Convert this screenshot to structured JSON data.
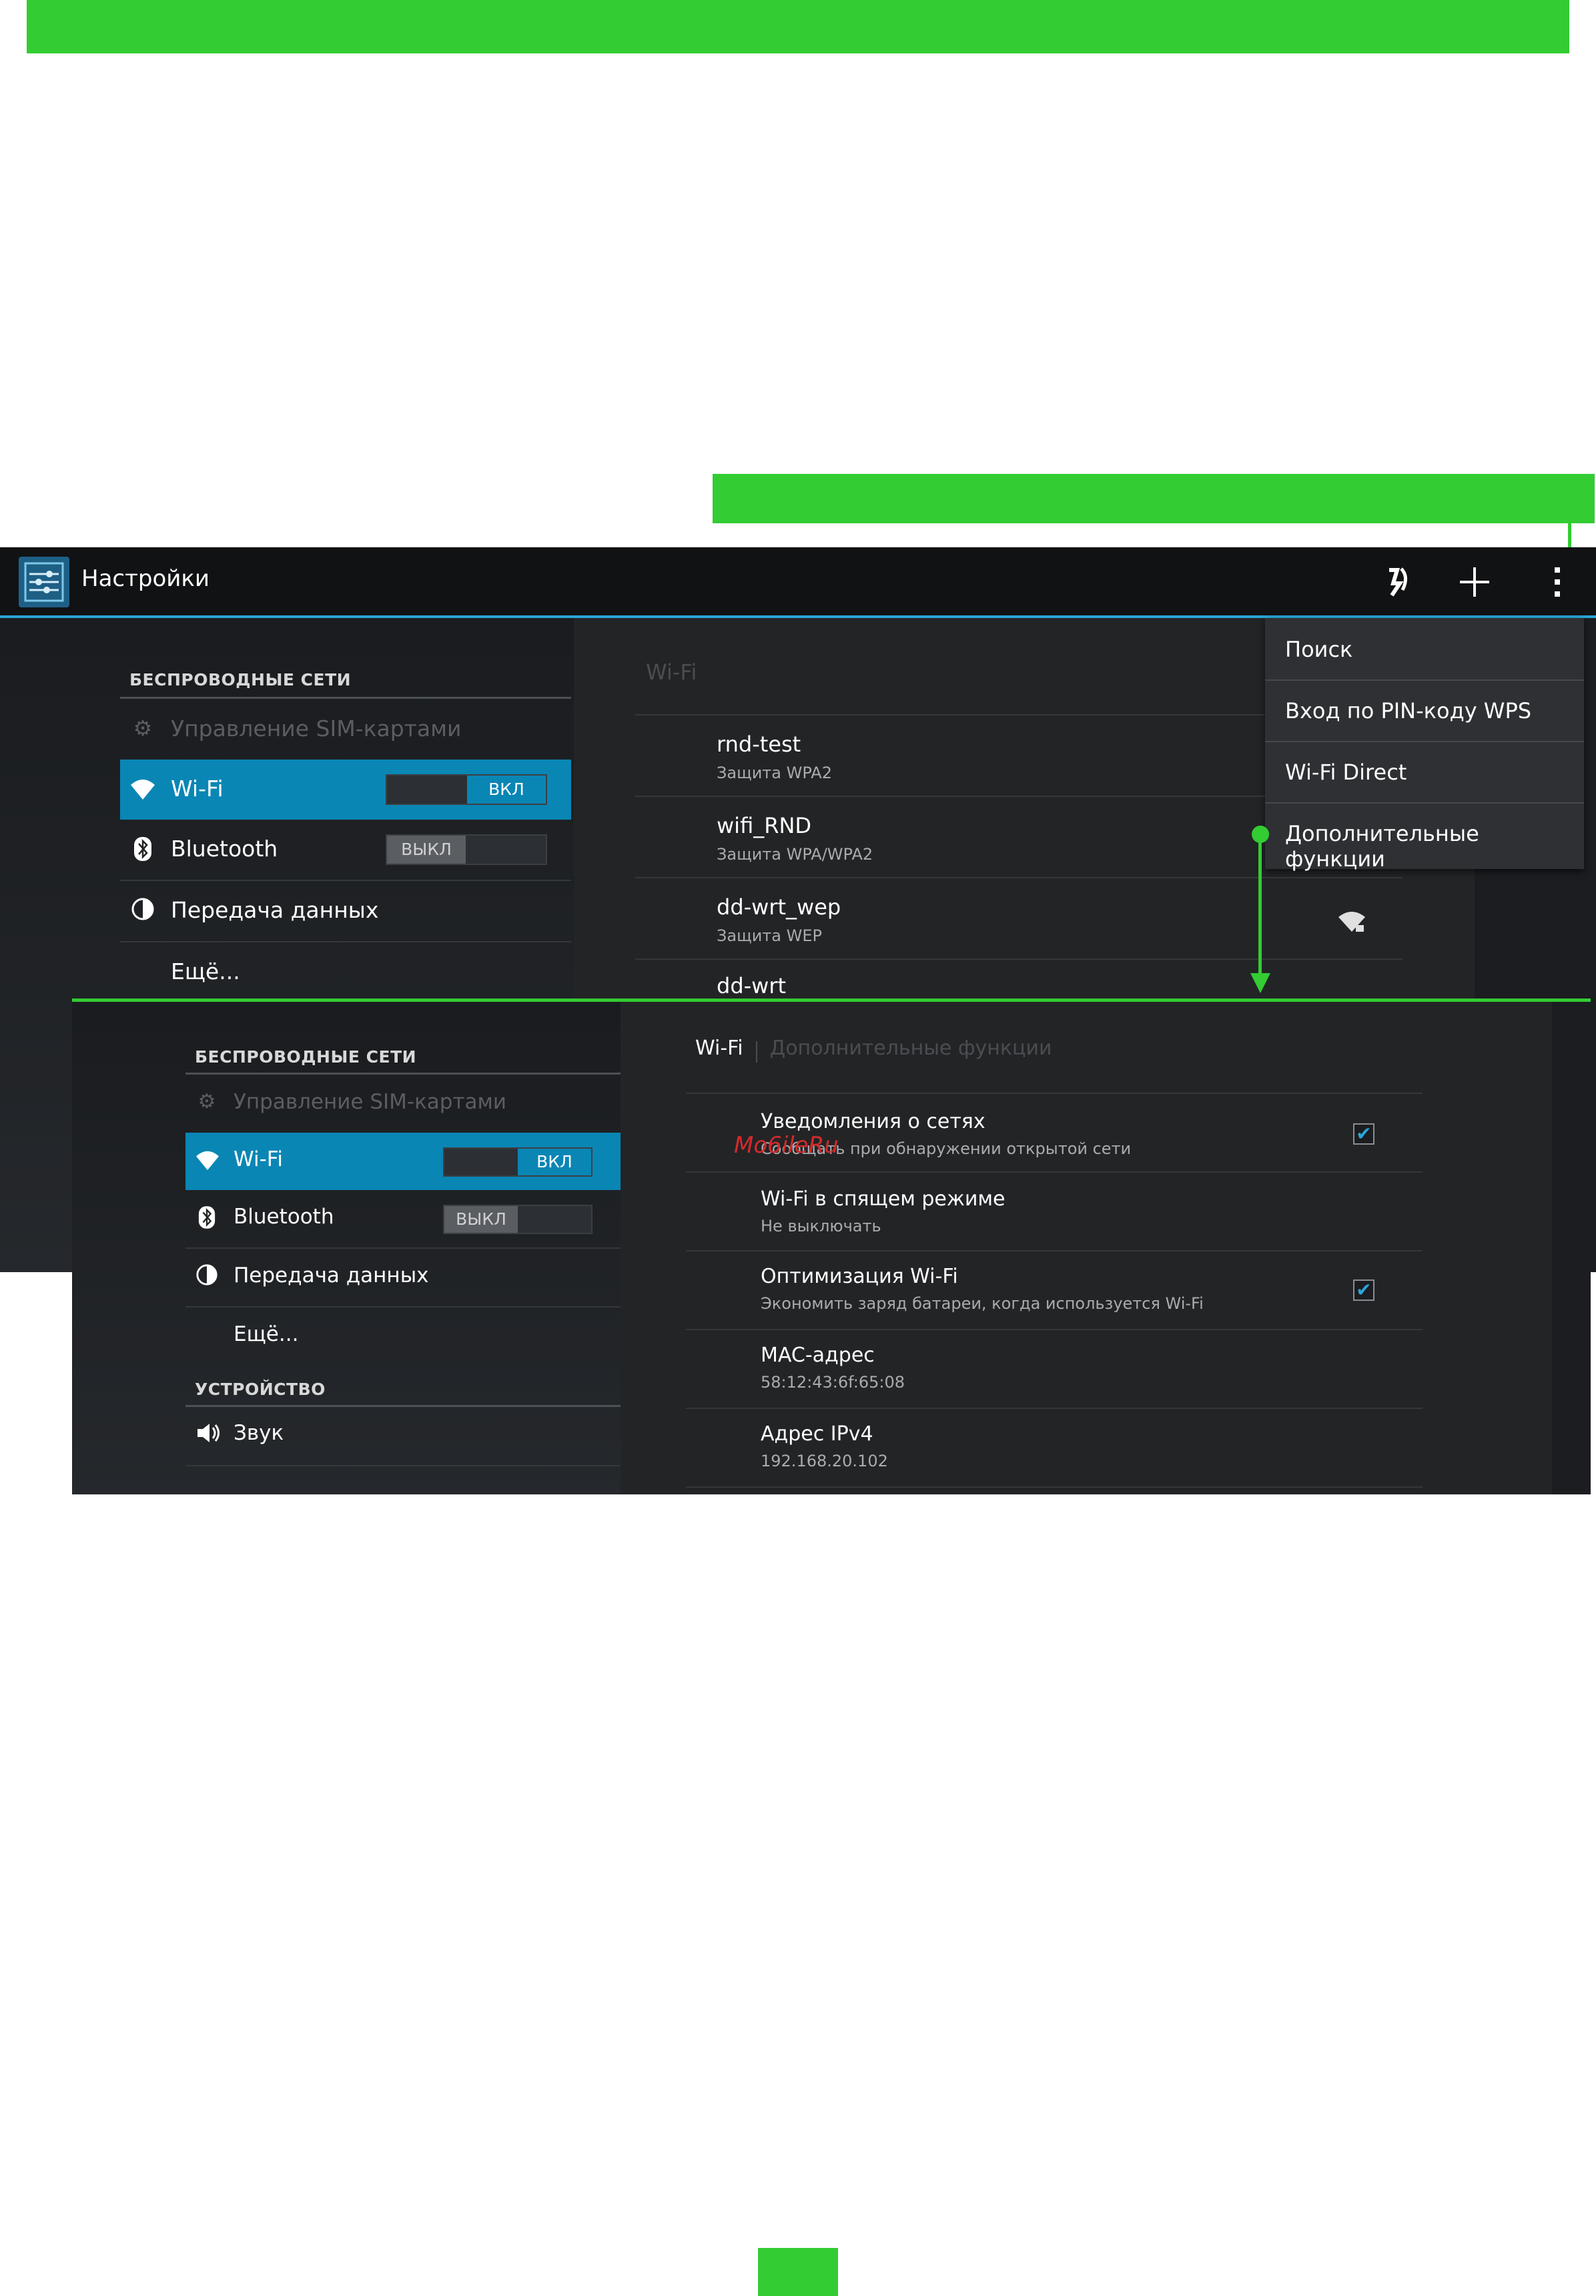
{
  "colors": {
    "accent_green": "#33cc33",
    "selected_blue": "#0a86b5",
    "actionbar_line": "#2aa6d8"
  },
  "watermark": "Mo6ileRu",
  "shot1": {
    "app_title": "Настройки",
    "actionbar_icons": [
      "sync-icon",
      "add-icon",
      "overflow-menu-icon"
    ],
    "sidebar": {
      "header": "БЕСПРОВОДНЫЕ СЕТИ",
      "items": [
        {
          "label": "Управление SIM-картами",
          "icon": "sim-settings-icon"
        },
        {
          "label": "Wi-Fi",
          "icon": "wifi-icon",
          "toggle": "ВКЛ"
        },
        {
          "label": "Bluetooth",
          "icon": "bluetooth-icon",
          "toggle": "ВЫКЛ"
        },
        {
          "label": "Передача данных",
          "icon": "data-usage-icon"
        },
        {
          "label": "Ещё..."
        }
      ]
    },
    "panel": {
      "title": "Wi-Fi",
      "networks": [
        {
          "name": "rnd-test",
          "security": "Защита WPA2"
        },
        {
          "name": "wifi_RND",
          "security": "Защита WPA/WPA2"
        },
        {
          "name": "dd-wrt_wep",
          "security": "Защита WEP"
        },
        {
          "name": "dd-wrt",
          "security": ""
        }
      ]
    },
    "menu": {
      "items": [
        "Поиск",
        "Вход по PIN-коду WPS",
        "Wi-Fi Direct",
        "Дополнительные функции"
      ]
    }
  },
  "shot2": {
    "sidebar": {
      "header_wireless": "БЕСПРОВОДНЫЕ СЕТИ",
      "header_device": "УСТРОЙСТВО",
      "items": [
        {
          "label": "Управление SIM-картами"
        },
        {
          "label": "Wi-Fi",
          "toggle": "ВКЛ"
        },
        {
          "label": "Bluetooth",
          "toggle": "ВЫКЛ"
        },
        {
          "label": "Передача данных"
        },
        {
          "label": "Ещё..."
        },
        {
          "label": "Звук"
        }
      ]
    },
    "breadcrumb": {
      "root": "Wi-Fi",
      "current": "Дополнительные функции"
    },
    "options": [
      {
        "title": "Уведомления о сетях",
        "subtitle": "Сообщать при обнаружении открытой сети",
        "checked": true
      },
      {
        "title": "Wi-Fi в спящем режиме",
        "subtitle": "Не выключать"
      },
      {
        "title": "Оптимизация Wi-Fi",
        "subtitle": "Экономить заряд батареи, когда используется Wi-Fi",
        "checked": true
      },
      {
        "title": "MAC-адрес",
        "subtitle": "58:12:43:6f:65:08"
      },
      {
        "title": "Адрес IPv4",
        "subtitle": "192.168.20.102"
      }
    ]
  }
}
